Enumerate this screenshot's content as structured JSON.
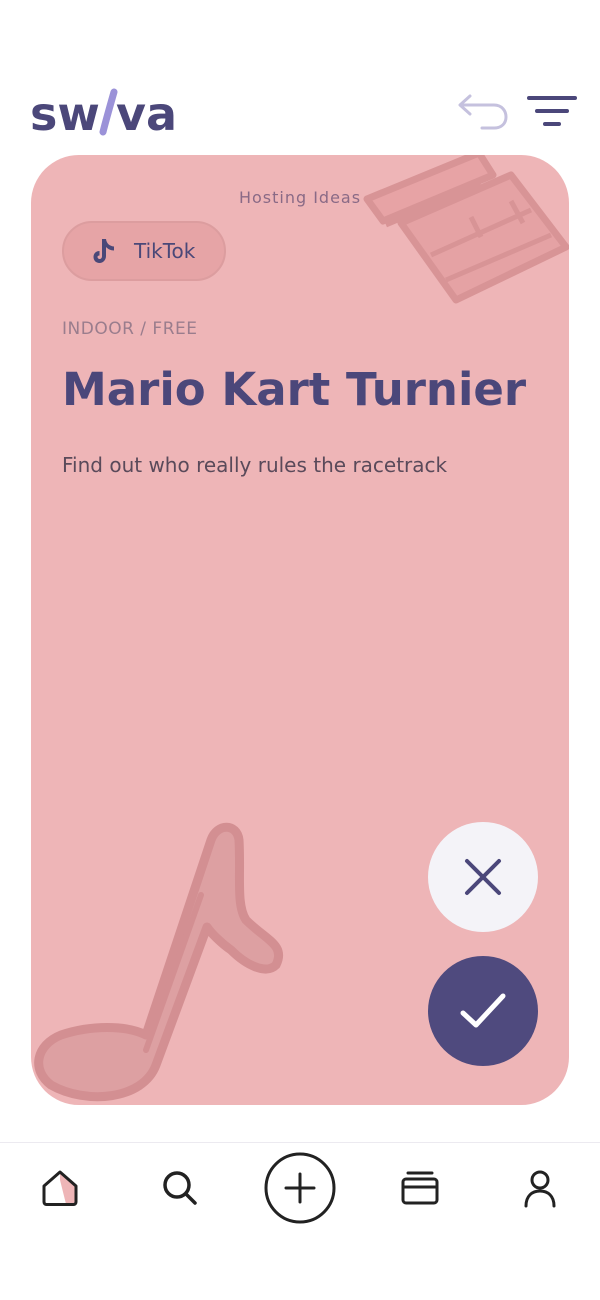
{
  "header": {
    "logo_text": "swiva",
    "undo_icon": "undo-icon",
    "filter_icon": "filter-icon"
  },
  "card": {
    "category": "Hosting Ideas",
    "source_pill": {
      "icon": "tiktok-icon",
      "label": "TikTok"
    },
    "meta": "INDOOR / FREE",
    "title": "Mario Kart Turnier",
    "description": "Find out who really rules the racetrack",
    "decorations": [
      "clapperboard-icon",
      "music-note-icon"
    ]
  },
  "actions": {
    "reject_icon": "close-icon",
    "accept_icon": "check-icon"
  },
  "nav": {
    "items": [
      {
        "icon": "home-icon",
        "active": true
      },
      {
        "icon": "search-icon"
      },
      {
        "icon": "add-circle-icon"
      },
      {
        "icon": "archive-icon"
      },
      {
        "icon": "profile-icon"
      }
    ]
  },
  "colors": {
    "brand": "#4b477a",
    "card_bg": "#eeb5b7",
    "accept_bg": "#4f4a7e",
    "reject_bg": "#f4f3f8",
    "logo_accent": "#9b92d8"
  }
}
